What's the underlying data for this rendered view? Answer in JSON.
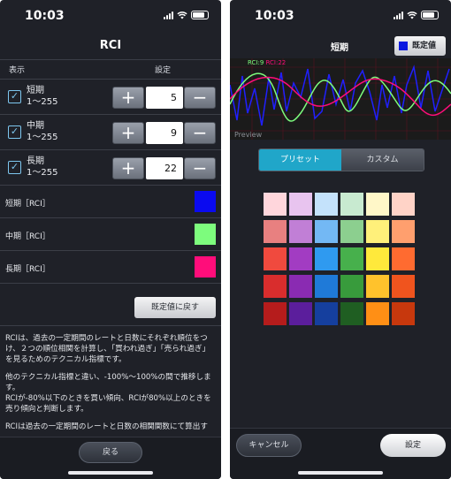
{
  "status": {
    "time": "10:03"
  },
  "left": {
    "title": "RCI",
    "header": {
      "col1": "表示",
      "col2": "設定"
    },
    "params": [
      {
        "name": "短期",
        "range": "1～255",
        "value": "5",
        "checked": true
      },
      {
        "name": "中期",
        "range": "1～255",
        "value": "9",
        "checked": true
      },
      {
        "name": "長期",
        "range": "1～255",
        "value": "22",
        "checked": true
      }
    ],
    "plus": "+",
    "minus": "−",
    "check_glyph": "✓",
    "colors": [
      {
        "label": "短期［RCI］",
        "color": "#0a0af0"
      },
      {
        "label": "中期［RCI］",
        "color": "#7dfc7d"
      },
      {
        "label": "長期［RCI］",
        "color": "#ff0d7a"
      }
    ],
    "reset_label": "既定値に戻す",
    "desc": [
      "RCIは、過去の一定期間のレートと日数にそれぞれ順位をつけ、２つの順位相関を計算し、「買われ過ぎ」「売られ過ぎ」を見るためのテクニカル指標です。",
      "他のテクニカル指標と違い、-100%～100%の間で推移します。",
      "RCIが-80%以下のときを買い傾向、RCIが80%以上のときを売り傾向と判断します。",
      "RCIは過去の一定期間のレートと日数の相関関数にて算出す"
    ],
    "back_label": "戻る"
  },
  "right": {
    "title": "短期",
    "default_label": "既定値",
    "default_color": "#0a18e0",
    "chart_labels": [
      {
        "text": "RCI:9",
        "color": "#7dfc7d"
      },
      {
        "text": "RCI:22",
        "color": "#ff0d7a"
      }
    ],
    "preview_label": "Preview",
    "tabs": [
      {
        "label": "プリセット",
        "active": true
      },
      {
        "label": "カスタム",
        "active": false
      }
    ],
    "palette": [
      "#ffd6dc",
      "#e8c4ef",
      "#c4e2fb",
      "#c8ead0",
      "#fff7c8",
      "#ffd3c7",
      "#e88080",
      "#c17fd6",
      "#73b8f4",
      "#8ccf8f",
      "#fff07a",
      "#ff9f6e",
      "#f04a3e",
      "#a23cc2",
      "#2f9af0",
      "#47b04c",
      "#ffe93b",
      "#ff6b30",
      "#d92d2d",
      "#8a2bb2",
      "#1f7ad8",
      "#389b3c",
      "#ffc22c",
      "#f0541e",
      "#b51c1c",
      "#5b1e9c",
      "#153f9e",
      "#1f5e22",
      "#ff8f15",
      "#c7380d"
    ],
    "cancel_label": "キャンセル",
    "ok_label": "設定"
  }
}
